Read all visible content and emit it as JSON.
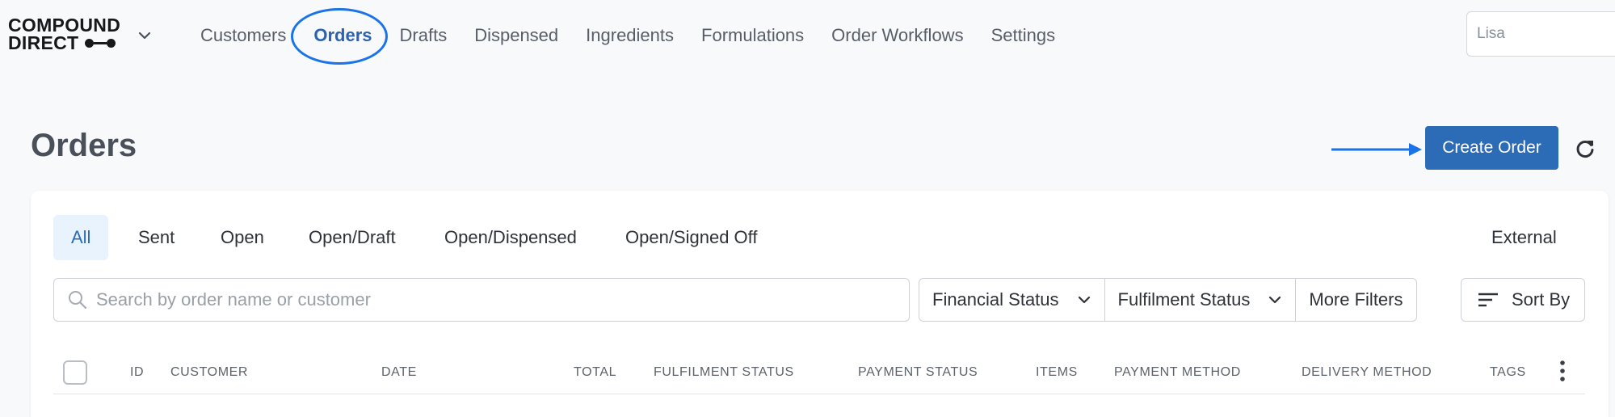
{
  "brand": {
    "line1": "COMPOUND",
    "line2": "DIRECT"
  },
  "nav": {
    "items": [
      "Customers",
      "Orders",
      "Drafts",
      "Dispensed",
      "Ingredients",
      "Formulations",
      "Order Workflows",
      "Settings"
    ],
    "active": "Orders"
  },
  "user": {
    "name": "Lisa"
  },
  "page": {
    "title": "Orders",
    "create_label": "Create Order"
  },
  "tabs": {
    "all": "All",
    "sent": "Sent",
    "open": "Open",
    "open_draft": "Open/Draft",
    "open_dispensed": "Open/Dispensed",
    "open_signed_off": "Open/Signed Off",
    "external": "External",
    "active": "All"
  },
  "search": {
    "placeholder": "Search by order name or customer",
    "value": ""
  },
  "filters": {
    "financial": "Financial Status",
    "fulfilment": "Fulfilment Status",
    "more": "More Filters",
    "sort": "Sort By"
  },
  "table": {
    "columns": {
      "id": "ID",
      "customer": "CUSTOMER",
      "date": "DATE",
      "total": "TOTAL",
      "fulfilment": "FULFILMENT STATUS",
      "payment_status": "PAYMENT STATUS",
      "items": "ITEMS",
      "payment_method": "PAYMENT METHOD",
      "delivery": "DELIVERY METHOD",
      "tags": "TAGS"
    }
  },
  "colors": {
    "accent": "#2c6cb6",
    "annotation": "#1a73e8",
    "active_tab_bg": "#e9f3fd"
  }
}
